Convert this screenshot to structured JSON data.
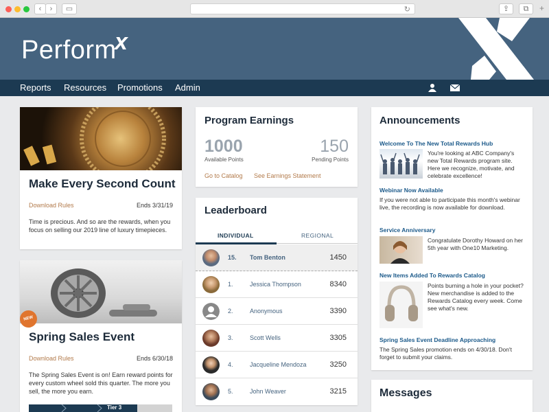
{
  "header": {
    "logo_text": "Perform",
    "logo_mark": "x"
  },
  "nav": {
    "items": [
      "Reports",
      "Resources",
      "Promotions",
      "Admin"
    ]
  },
  "cards": [
    {
      "title": "Make Every Second Count",
      "rules_link": "Download Rules",
      "ends": "Ends 3/31/19",
      "text": "Time is precious. And so are the rewards, when you focus on selling our 2019 line of luxury timepieces."
    },
    {
      "title": "Spring Sales Event",
      "rules_link": "Download Rules",
      "ends": "Ends 6/30/18",
      "badge": "NEW",
      "text": "The Spring Sales Event is on! Earn reward points for every custom wheel sold this quarter. The more you sell, the more you earn.",
      "tier_label": "Tier 3"
    }
  ],
  "earnings": {
    "title": "Program Earnings",
    "available_value": "1000",
    "available_label": "Available Points",
    "pending_value": "150",
    "pending_label": "Pending Points",
    "catalog_link": "Go to Catalog",
    "statement_link": "See Earnings Statement"
  },
  "leaderboard": {
    "title": "Leaderboard",
    "tabs": [
      "INDIVIDUAL",
      "REGIONAL"
    ],
    "rows": [
      {
        "rank": "15.",
        "name": "Tom Benton",
        "points": "1450",
        "current": true
      },
      {
        "rank": "1.",
        "name": "Jessica Thompson",
        "points": "8340"
      },
      {
        "rank": "2.",
        "name": "Anonymous",
        "points": "3390"
      },
      {
        "rank": "3.",
        "name": "Scott Wells",
        "points": "3305"
      },
      {
        "rank": "4.",
        "name": "Jacqueline Mendoza",
        "points": "3250"
      },
      {
        "rank": "5.",
        "name": "John Weaver",
        "points": "3215"
      }
    ]
  },
  "announcements": {
    "title": "Announcements",
    "items": [
      {
        "heading": "Welcome To The New Total Rewards Hub",
        "text": "You're looking at ABC Company's new Total Rewards program site. Here we recognize, motivate, and celebrate excellence!"
      },
      {
        "heading": "Webinar Now Available",
        "text": "If you were not able to participate this month's webinar live, the recording is now available for download."
      },
      {
        "heading": "Service Anniversary",
        "text": "Congratulate Dorothy Howard on her 5th year with One10 Marketing."
      },
      {
        "heading": "New Items Added To Rewards Catalog",
        "text": "Points burning a hole in your pocket? New merchandise is added to the Rewards Catalog every week. Come see what's new."
      },
      {
        "heading": "Spring Sales Event Deadline Approaching",
        "text": "The Spring Sales promotion ends on 4/30/18. Don't forget to submit your claims."
      }
    ]
  },
  "messages": {
    "title": "Messages"
  },
  "colors": {
    "header": "#45637f",
    "navbar": "#1c3a52",
    "accent_link": "#b27a4a",
    "badge": "#e0752e"
  }
}
